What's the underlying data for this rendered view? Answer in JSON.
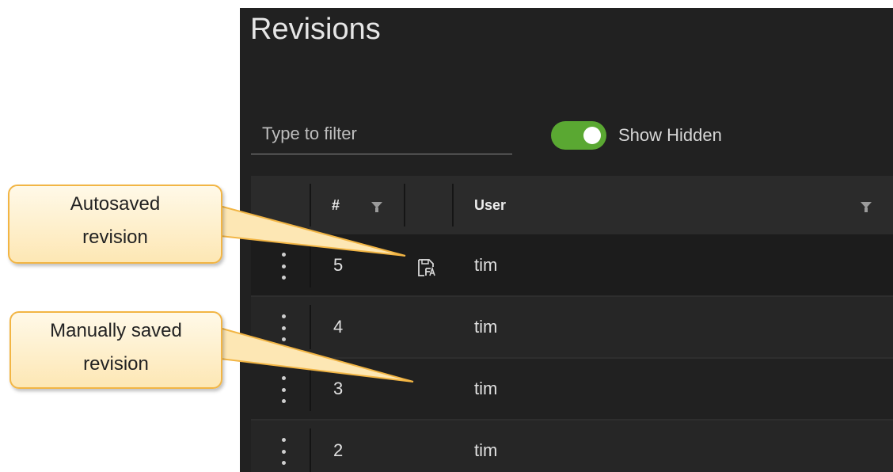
{
  "panel": {
    "title": "Revisions",
    "filter": {
      "placeholder": "Type to filter",
      "value": ""
    },
    "toggle": {
      "label": "Show Hidden",
      "on": true,
      "color": "#5aa832"
    }
  },
  "table": {
    "columns": [
      {
        "label": "#",
        "filter_icon": "funnel-icon"
      },
      {
        "label": "",
        "icon_column": true
      },
      {
        "label": "User",
        "filter_icon": "funnel-icon"
      }
    ],
    "rows": [
      {
        "number": "5",
        "autosaved": true,
        "user": "tim"
      },
      {
        "number": "4",
        "autosaved": false,
        "user": "tim"
      },
      {
        "number": "3",
        "autosaved": false,
        "user": "tim"
      },
      {
        "number": "2",
        "autosaved": false,
        "user": "tim"
      }
    ]
  },
  "callouts": {
    "autosaved": [
      "Autosaved",
      "revision"
    ],
    "manual": [
      "Manually saved",
      "revision"
    ]
  },
  "colors": {
    "panel_bg": "#212121",
    "callout_border": "#f2b544",
    "callout_fill": "#fde7b4"
  }
}
